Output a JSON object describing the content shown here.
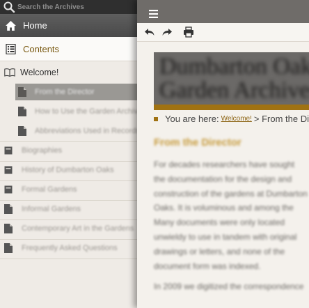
{
  "search": {
    "placeholder": "Search the Archives"
  },
  "nav": {
    "home_label": "Home",
    "contents_label": "Contents"
  },
  "tree": {
    "welcome": "Welcome!",
    "welcome_children": [
      {
        "label": "From the Director",
        "selected": true
      },
      {
        "label": "How to Use the Garden Archives",
        "selected": false
      },
      {
        "label": "Abbreviations Used in Records",
        "selected": false
      }
    ],
    "sections": [
      {
        "label": "Biographies",
        "icon": "book-icon"
      },
      {
        "label": "History of Dumbarton Oaks",
        "icon": "book-icon"
      },
      {
        "label": "Formal Gardens",
        "icon": "book-icon"
      },
      {
        "label": "Informal Gardens",
        "icon": "document-icon"
      },
      {
        "label": "Contemporary Art in the Gardens",
        "icon": "document-icon"
      },
      {
        "label": "Frequently Asked Questions",
        "icon": "document-icon"
      }
    ]
  },
  "main": {
    "banner_lines": [
      "Dumbarton Oaks",
      "Garden Archives"
    ],
    "breadcrumb": {
      "prefix": "You are here:",
      "link": "Welcome!",
      "suffix": "> From the Director"
    },
    "heading": "From the Director",
    "paragraphs": [
      [
        "For decades researchers have sought",
        "the documentation for the design and",
        "construction of the gardens at Dumbarton",
        "Oaks. It is voluminous and among the",
        "Many documents were only located",
        "unwieldy to use in tandem with original",
        "drawings or letters, and none of the",
        "document form was indexed."
      ],
      [
        "In 2009 we digitized the correspondence"
      ]
    ]
  },
  "colors": {
    "accent_gold": "#a07212",
    "topbar": "#6f6c69",
    "search_bar": "#2f2f2f",
    "selected_item": "#9a9894"
  }
}
